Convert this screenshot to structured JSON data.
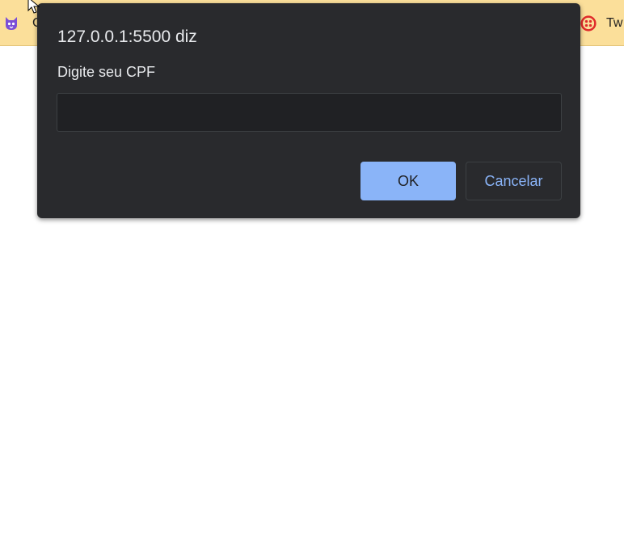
{
  "bookmarks": [
    {
      "label": "C",
      "icon": "purple-cat-icon"
    },
    {
      "label": "Tw",
      "icon": "twilio-icon"
    }
  ],
  "dialog": {
    "title": "127.0.0.1:5500 diz",
    "message": "Digite seu CPF",
    "input_value": "",
    "ok_label": "OK",
    "cancel_label": "Cancelar"
  },
  "colors": {
    "dialog_bg": "#292a2d",
    "accent": "#8ab4f8",
    "bookmark_bar": "#fbdf9a",
    "twilio_red": "#e02b2b"
  }
}
